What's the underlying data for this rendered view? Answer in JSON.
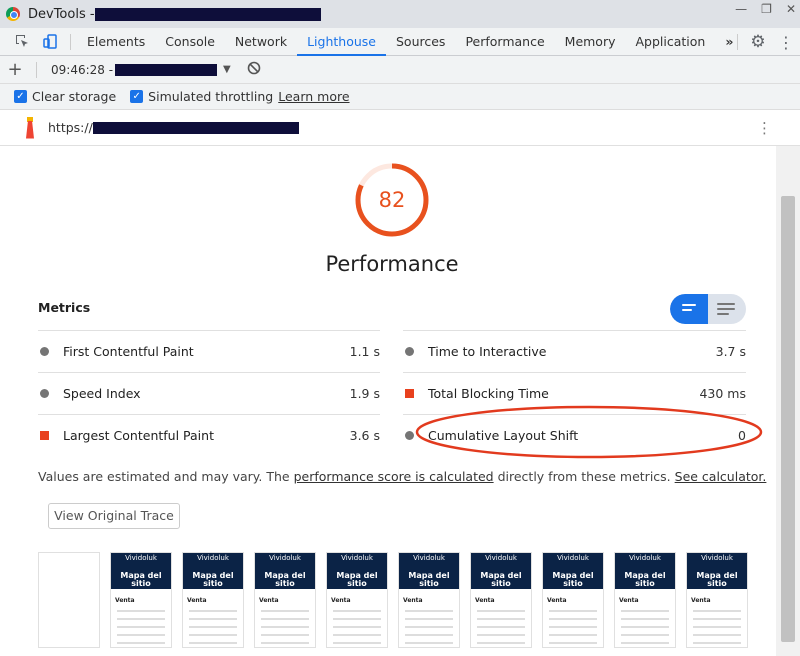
{
  "window": {
    "title": "DevTools - ",
    "controls": [
      "—",
      "❐",
      "✕"
    ]
  },
  "devtools_tabs": [
    "Elements",
    "Console",
    "Network",
    "Lighthouse",
    "Sources",
    "Performance",
    "Memory",
    "Application"
  ],
  "active_tab": "Lighthouse",
  "overflow_label": "»",
  "lighthouse_toolbar": {
    "time": "09:46:28 - "
  },
  "options": {
    "clear_storage": "Clear storage",
    "simulated_throttling": "Simulated throttling",
    "learn_more": "Learn more"
  },
  "url": {
    "prefix": "https://"
  },
  "score": {
    "value": "82",
    "value_fraction": 0.82,
    "title": "Performance",
    "color": "#e8511e"
  },
  "metrics": {
    "heading": "Metrics",
    "left": [
      {
        "name": "First Contentful Paint",
        "value": "1.1 s",
        "status": "average"
      },
      {
        "name": "Speed Index",
        "value": "1.9 s",
        "status": "average"
      },
      {
        "name": "Largest Contentful Paint",
        "value": "3.6 s",
        "status": "fail"
      }
    ],
    "right": [
      {
        "name": "Time to Interactive",
        "value": "3.7 s",
        "status": "average"
      },
      {
        "name": "Total Blocking Time",
        "value": "430 ms",
        "status": "fail"
      },
      {
        "name": "Cumulative Layout Shift",
        "value": "0",
        "status": "average"
      }
    ]
  },
  "note": {
    "text1": "Values are estimated and may vary. The ",
    "link1": "performance score is calculated",
    "text2": " directly from these metrics. ",
    "link2": "See calculator."
  },
  "view_trace_label": "View Original Trace",
  "filmstrip": {
    "frame_title": "Mapa del sitio",
    "frame_brand": "Vividoluk",
    "frame_section": "Venta"
  },
  "colors": {
    "accent": "#1a73e8",
    "fail": "#e8411e",
    "average": "#757575",
    "annotation": "#e23a1e"
  }
}
